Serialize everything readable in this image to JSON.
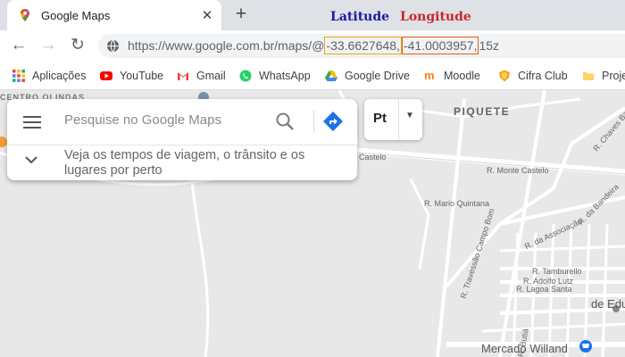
{
  "browser": {
    "tab_title": "Google Maps",
    "url_prefix": "https://www.google.com.br/maps/@",
    "latitude": "-33.6627648,",
    "longitude": "-41.0003957,",
    "url_suffix": "15z"
  },
  "annotations": {
    "latitude_label": "Latitude",
    "longitude_label": "Longitude"
  },
  "bookmarks": [
    {
      "label": "Aplicações"
    },
    {
      "label": "YouTube"
    },
    {
      "label": "Gmail"
    },
    {
      "label": "WhatsApp"
    },
    {
      "label": "Google Drive"
    },
    {
      "label": "Moodle"
    },
    {
      "label": "Cifra Club"
    },
    {
      "label": "Proje"
    }
  ],
  "maps": {
    "search_placeholder": "Pesquise no Google Maps",
    "nearby_text": "Veja os tempos de viagem, o trânsito e os lugares por perto",
    "layers_label": "Pt"
  },
  "map_labels": {
    "neighborhood": "PIQUETE",
    "area_top": "CENTRO OLINDAS",
    "r_castelo": "Castelo",
    "r_monte_castelo": "R. Monte Castelo",
    "r_chaves_barc": "R. Chaves Barc",
    "r_mario_quintana": "R. Mario Quintana",
    "r_da_bandeira": "R. da Bandeira",
    "r_travessao": "R. Travessão Campo Bom",
    "r_associacao": "R. da Associação",
    "r_tamburello": "R. Tamburello",
    "r_adolfo_lutz": "R. Adolfo Lutz",
    "r_lagoa_santa": "R. Lagoa Santa",
    "r_butia": "R. Butiá",
    "place_edu": "de Edu",
    "place_mercado": "Mercado Willand"
  }
}
